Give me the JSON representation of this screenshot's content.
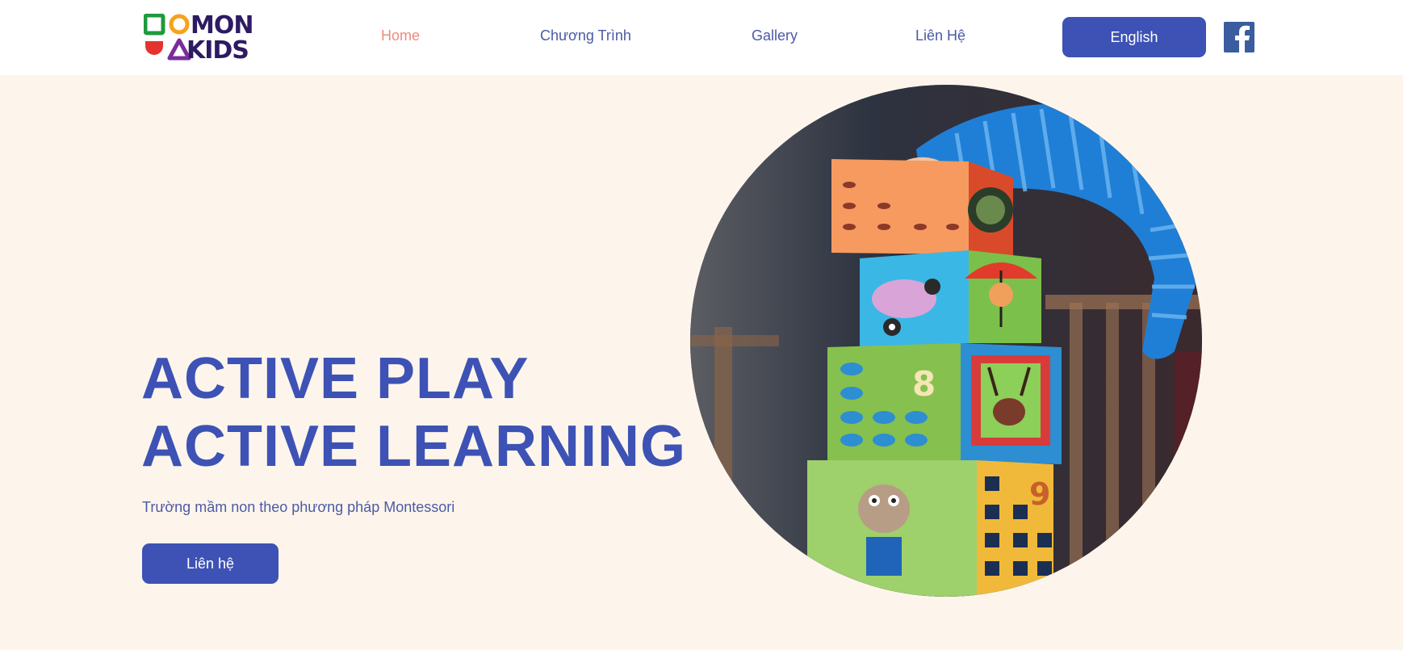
{
  "brand": {
    "logo_line1": "MON",
    "logo_line2": "KIDS"
  },
  "nav": {
    "items": [
      {
        "label": "Home",
        "active": true
      },
      {
        "label": "Chương Trình",
        "active": false
      },
      {
        "label": "Gallery",
        "active": false
      },
      {
        "label": "Liên Hệ",
        "active": false
      }
    ],
    "language_button": "English",
    "social_icon": "facebook-icon"
  },
  "hero": {
    "title_line1": "ACTIVE PLAY",
    "title_line2": "ACTIVE LEARNING",
    "subtitle": "Trường mầm non theo phương pháp Montessori",
    "cta_label": "Liên hệ",
    "image_description": "child stacking colorful picture blocks"
  },
  "colors": {
    "primary": "#3d52b4",
    "nav_text": "#4b5aa6",
    "nav_active": "#f08a7a",
    "hero_background": "#fdf5ec",
    "header_background": "#ffffff",
    "facebook": "#3b5c9f"
  }
}
